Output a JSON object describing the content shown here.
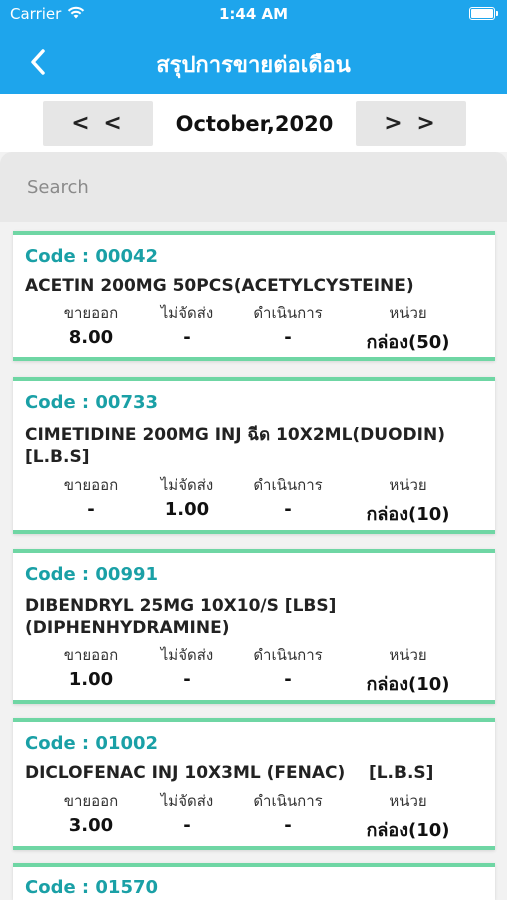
{
  "status": {
    "carrier": "Carrier",
    "time": "1:44 AM",
    "battery_level": 1.0
  },
  "nav": {
    "title": "สรุปการขายต่อเดือน"
  },
  "month": {
    "prev_label": "< <",
    "current": "October,2020",
    "next_label": "> >"
  },
  "search": {
    "placeholder": "Search"
  },
  "columns": [
    "ขายออก",
    "ไม่จัดส่ง",
    "ดำเนินการ",
    "หน่วย"
  ],
  "items": [
    {
      "code": "Code : 00042",
      "name": "ACETIN 200MG 50PCS(ACETYLCYSTEINE)",
      "sold": "8.00",
      "not_shipped": "-",
      "in_progress": "-",
      "unit": "กล่อง(50)"
    },
    {
      "code": "Code : 00733",
      "name": "CIMETIDINE 200MG INJ ฉีด 10X2ML(DUODIN)\n[L.B.S]",
      "sold": "-",
      "not_shipped": "1.00",
      "in_progress": "-",
      "unit": "กล่อง(10)"
    },
    {
      "code": "Code : 00991",
      "name": "DIBENDRYL 25MG 10X10/S [LBS]\n(DIPHENHYDRAMINE)",
      "sold": "1.00",
      "not_shipped": "-",
      "in_progress": "-",
      "unit": "กล่อง(10)"
    },
    {
      "code": "Code : 01002",
      "name": "DICLOFENAC INJ 10X3ML (FENAC)    [L.B.S]",
      "sold": "3.00",
      "not_shipped": "-",
      "in_progress": "-",
      "unit": "กล่อง(10)"
    },
    {
      "code": "Code : 01570"
    }
  ]
}
